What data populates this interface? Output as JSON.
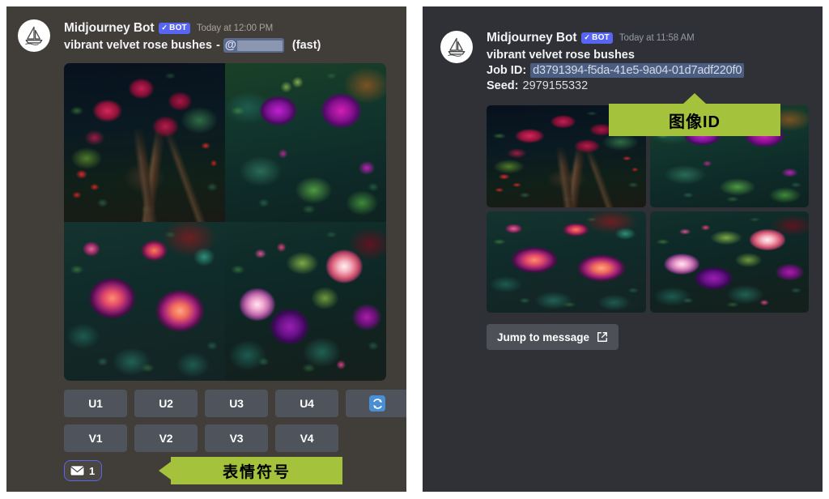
{
  "theme": {
    "left_panel_bg": "#413d38",
    "right_panel_bg": "#2f3136",
    "page_bg": "#ffffff",
    "bot_badge_color": "#5865f2",
    "callout_green": "#a4c23c",
    "button_gray": "#4f545c",
    "jobid_highlight": "#4b5e82",
    "reaction_border": "#5865f2"
  },
  "left_panel": {
    "avatar_icon": "sailboat-icon",
    "username": "Midjourney Bot",
    "bot_badge": {
      "check": "✓",
      "label": "BOT"
    },
    "timestamp": "Today at 12:00 PM",
    "prompt": {
      "text": "vibrant velvet rose bushes",
      "separator": "-",
      "mention_symbol": "@",
      "mention_redacted": true,
      "speed_tag": "(fast)"
    },
    "image_grid": {
      "layout": "2x2-composite",
      "tiles": [
        {
          "name": "crimson-roses-dark-navy",
          "alt": "deep crimson roses with red berries on dark navy ground"
        },
        {
          "name": "purple-magenta-roses-teal-leaves",
          "alt": "vivid purple and magenta roses among teal-green leaves"
        },
        {
          "name": "coral-purple-roses",
          "alt": "large coral-salmon roses with purple petal edges"
        },
        {
          "name": "pale-pink-and-purple-roses",
          "alt": "pale pink-white roses beside deep purple roses"
        }
      ]
    },
    "upscale_buttons": [
      "U1",
      "U2",
      "U3",
      "U4"
    ],
    "variation_buttons": [
      "V1",
      "V2",
      "V3",
      "V4"
    ],
    "reroll_button": {
      "icon": "refresh-icon",
      "label": ""
    },
    "reaction": {
      "icon": "envelope-icon",
      "count": "1"
    },
    "callout": {
      "text": "表情符号",
      "points": "left"
    }
  },
  "right_panel": {
    "avatar_icon": "sailboat-icon",
    "username": "Midjourney Bot",
    "bot_badge": {
      "check": "✓",
      "label": "BOT"
    },
    "timestamp": "Today at 11:58 AM",
    "prompt_title": "vibrant velvet rose bushes",
    "job_id": {
      "label": "Job ID",
      "separator": ":",
      "value": "d3791394-f5da-41e5-9a04-01d7adf220f0"
    },
    "seed": {
      "label": "Seed",
      "separator": ":",
      "value": "2979155332"
    },
    "image_grid": {
      "layout": "2x2-separate",
      "tiles": [
        {
          "name": "crimson-roses-dark-navy",
          "alt": "deep crimson roses with red berries on dark navy ground"
        },
        {
          "name": "purple-magenta-roses-teal-leaves",
          "alt": "vivid purple and magenta roses among teal-green leaves"
        },
        {
          "name": "coral-purple-roses",
          "alt": "large coral-salmon roses with purple petal edges"
        },
        {
          "name": "pale-pink-and-purple-roses",
          "alt": "pale pink-white roses beside deep purple roses"
        }
      ]
    },
    "jump_button": {
      "label": "Jump to message",
      "icon": "external-link-icon"
    },
    "callout": {
      "text": "图像ID",
      "points": "up"
    }
  }
}
